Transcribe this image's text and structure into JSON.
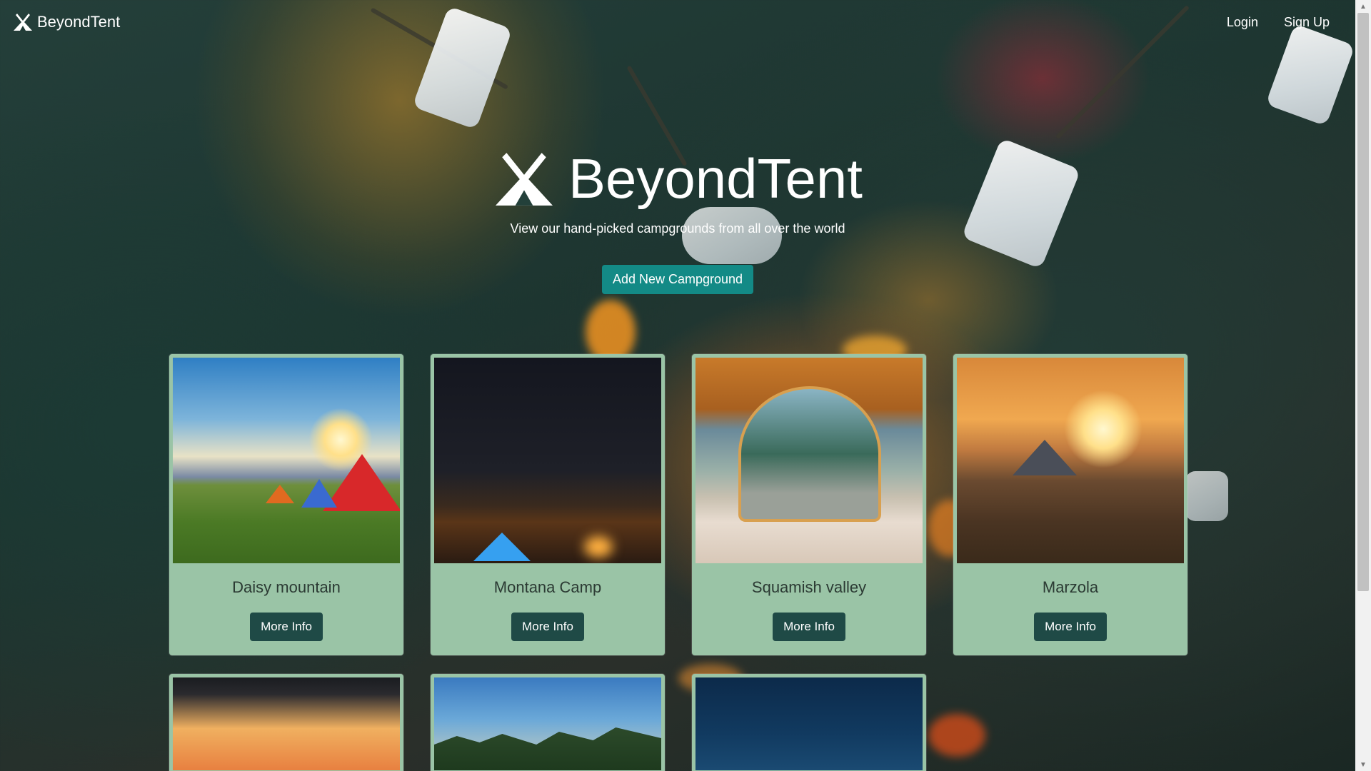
{
  "navbar": {
    "brand_name": "BeyondTent",
    "brand_icon": "tent-logo-icon",
    "login_label": "Login",
    "signup_label": "Sign Up"
  },
  "hero": {
    "title": "BeyondTent",
    "subtitle": "View our hand-picked campgrounds from all over the world",
    "add_button_label": "Add New Campground"
  },
  "campgrounds": [
    {
      "name": "Daisy mountain",
      "button_label": "More Info"
    },
    {
      "name": "Montana Camp",
      "button_label": "More Info"
    },
    {
      "name": "Squamish valley",
      "button_label": "More Info"
    },
    {
      "name": "Marzola",
      "button_label": "More Info"
    }
  ],
  "colors": {
    "card_background": "#9ac4a6",
    "add_button": "#138a86",
    "more_info_button": "#1f4a46"
  }
}
